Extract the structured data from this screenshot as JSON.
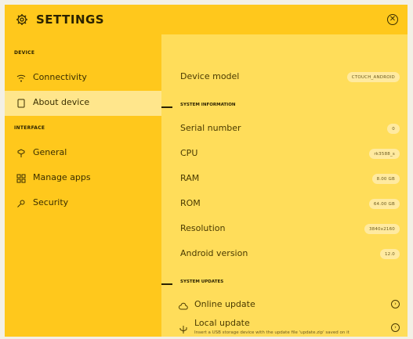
{
  "header": {
    "title": "SETTINGS",
    "settings_icon": "gear-icon",
    "close_icon": "close-circle-icon"
  },
  "sidebar": {
    "sections": [
      {
        "label": "DEVICE",
        "items": [
          {
            "label": "Connectivity",
            "icon": "wifi-icon",
            "active": false
          },
          {
            "label": "About device",
            "icon": "tablet-icon",
            "active": true
          }
        ]
      },
      {
        "label": "INTERFACE",
        "items": [
          {
            "label": "General",
            "icon": "general-icon",
            "active": false
          },
          {
            "label": "Manage apps",
            "icon": "apps-grid-icon",
            "active": false
          },
          {
            "label": "Security",
            "icon": "key-icon",
            "active": false
          }
        ]
      }
    ]
  },
  "main": {
    "device_model": {
      "label": "Device model",
      "value": "CTOUCH_ANDROID"
    },
    "system_information": {
      "title": "SYSTEM INFORMATION",
      "rows": [
        {
          "label": "Serial number",
          "value": "0"
        },
        {
          "label": "CPU",
          "value": "rk3588_s"
        },
        {
          "label": "RAM",
          "value": "8.00 GB"
        },
        {
          "label": "ROM",
          "value": "64.00 GB"
        },
        {
          "label": "Resolution",
          "value": "3840x2160"
        },
        {
          "label": "Android version",
          "value": "12.0"
        }
      ]
    },
    "system_updates": {
      "title": "SYSTEM UPDATES",
      "online": {
        "label": "Online update",
        "icon": "cloud-icon"
      },
      "local": {
        "label": "Local update",
        "description": "Insert a USB storage device with the update file 'update.zip' saved on it",
        "icon": "usb-icon"
      }
    }
  },
  "colors": {
    "primary_yellow": "#ffc81c",
    "panel_yellow": "#ffdd5a",
    "active_item": "#ffe68c",
    "badge": "#ffeaa0",
    "text_dark": "#2b2200"
  }
}
